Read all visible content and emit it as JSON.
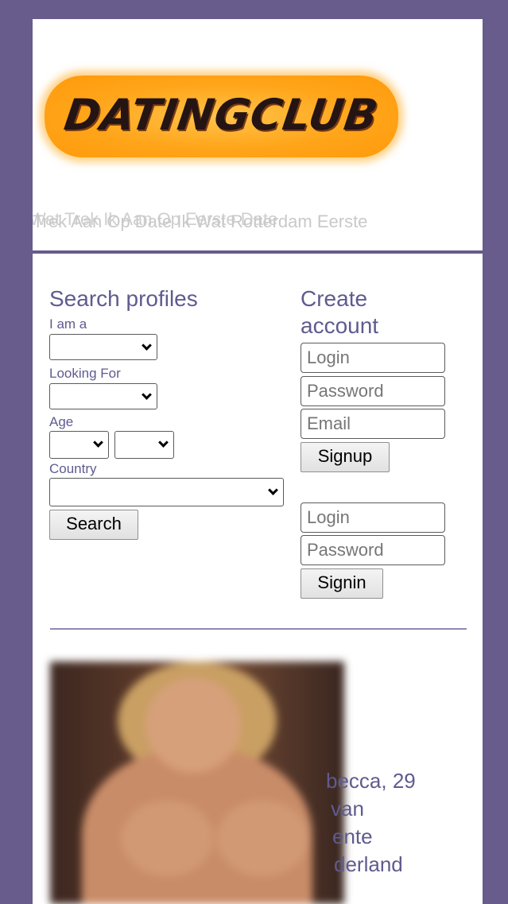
{
  "site": {
    "logo_text": "DATINGCLUB",
    "tagline_line1": "Wat Trek Ik Aan Op Eerste Date",
    "tagline_line2": "Trek Aan Op Date Ik Wat Rotterdam Eerste",
    "accent_color": "#675c8c",
    "logo_color": "#ffa51a"
  },
  "search": {
    "title": "Search profiles",
    "i_am_label": "I am a",
    "looking_for_label": "Looking For",
    "age_label": "Age",
    "country_label": "Country",
    "search_button": "Search"
  },
  "create_account": {
    "title_line1": "Create",
    "title_line2": "account",
    "login_placeholder": "Login",
    "password_placeholder": "Password",
    "email_placeholder": "Email",
    "signup_button": "Signup"
  },
  "signin": {
    "login_placeholder": "Login",
    "password_placeholder": "Password",
    "signin_button": "Signin"
  },
  "profile": {
    "name_age": "becca, 29",
    "line2": "van",
    "line3": "ente",
    "line4": "derland"
  }
}
